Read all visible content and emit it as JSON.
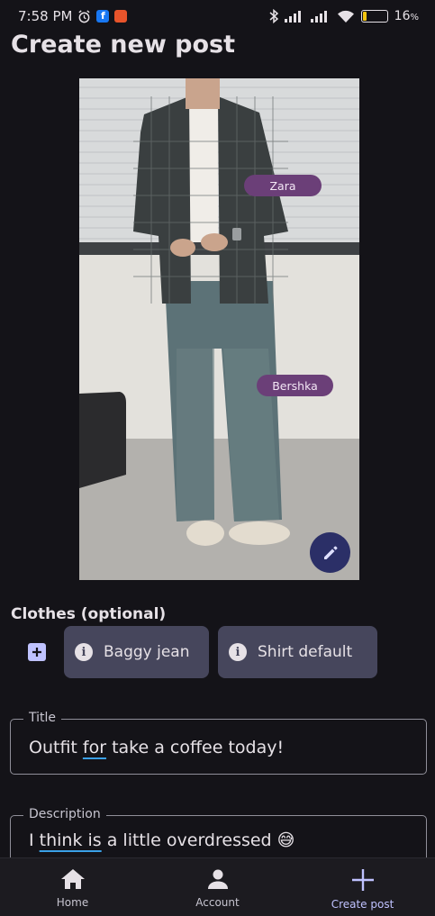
{
  "status_bar": {
    "time": "7:58 PM",
    "battery_percent": "16",
    "battery_level": 0.16
  },
  "page": {
    "title": "Create new post"
  },
  "photo": {
    "tags": [
      {
        "label": "Zara"
      },
      {
        "label": "Bershka"
      }
    ],
    "edit_icon": "pencil-icon"
  },
  "clothes": {
    "section_label": "Clothes (optional)",
    "add_icon": "plus-square-icon",
    "items": [
      {
        "label": "Baggy jean",
        "icon": "info-icon"
      },
      {
        "label": "Shirt default",
        "icon": "info-icon"
      }
    ]
  },
  "title_field": {
    "label": "Title",
    "value_parts": [
      "Outfit ",
      "for",
      " take a coffee today!"
    ]
  },
  "description_field": {
    "label": "Description",
    "value_parts": [
      "I ",
      "think is",
      " a little overdressed 😅"
    ]
  },
  "bottom_nav": {
    "items": [
      {
        "label": "Home",
        "icon": "home-icon"
      },
      {
        "label": "Account",
        "icon": "person-icon"
      },
      {
        "label": "Create post",
        "icon": "plus-icon",
        "active": true
      }
    ]
  },
  "colors": {
    "background": "#141318",
    "accent": "#bfc2ff",
    "tag_chip": "#6b3f78",
    "clothes_chip": "#46465c",
    "fab": "#2b2f67"
  }
}
